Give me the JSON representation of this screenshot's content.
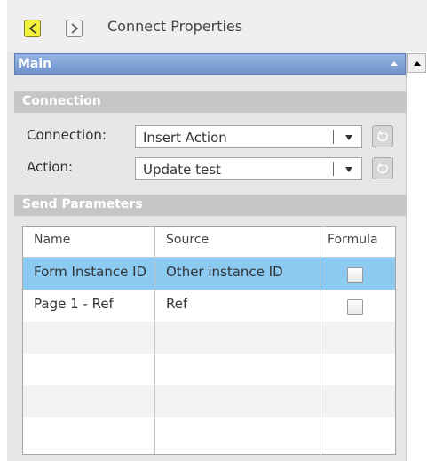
{
  "header": {
    "title": "Connect Properties"
  },
  "main_section": {
    "title": "Main"
  },
  "connection_section": {
    "title": "Connection",
    "connection_label": "Connection:",
    "connection_value": "Insert Action",
    "action_label": "Action:",
    "action_value": "Update test"
  },
  "send_section": {
    "title": "Send Parameters",
    "columns": [
      "Name",
      "Source",
      "Formula"
    ],
    "rows": [
      {
        "name": "Form Instance ID",
        "source": "Other instance ID",
        "formula": false
      },
      {
        "name": "Page 1 - Ref",
        "source": "Ref",
        "formula": false
      }
    ]
  },
  "colors": {
    "selected_row": "#8ccaf2",
    "section_header": "#c6c6c6",
    "main_header": "#7b9fd6",
    "back_button": "#f2f03a"
  },
  "icons": [
    "back-arrow-icon",
    "forward-arrow-icon",
    "refresh-icon",
    "collapse-icon",
    "scroll-up-icon"
  ]
}
